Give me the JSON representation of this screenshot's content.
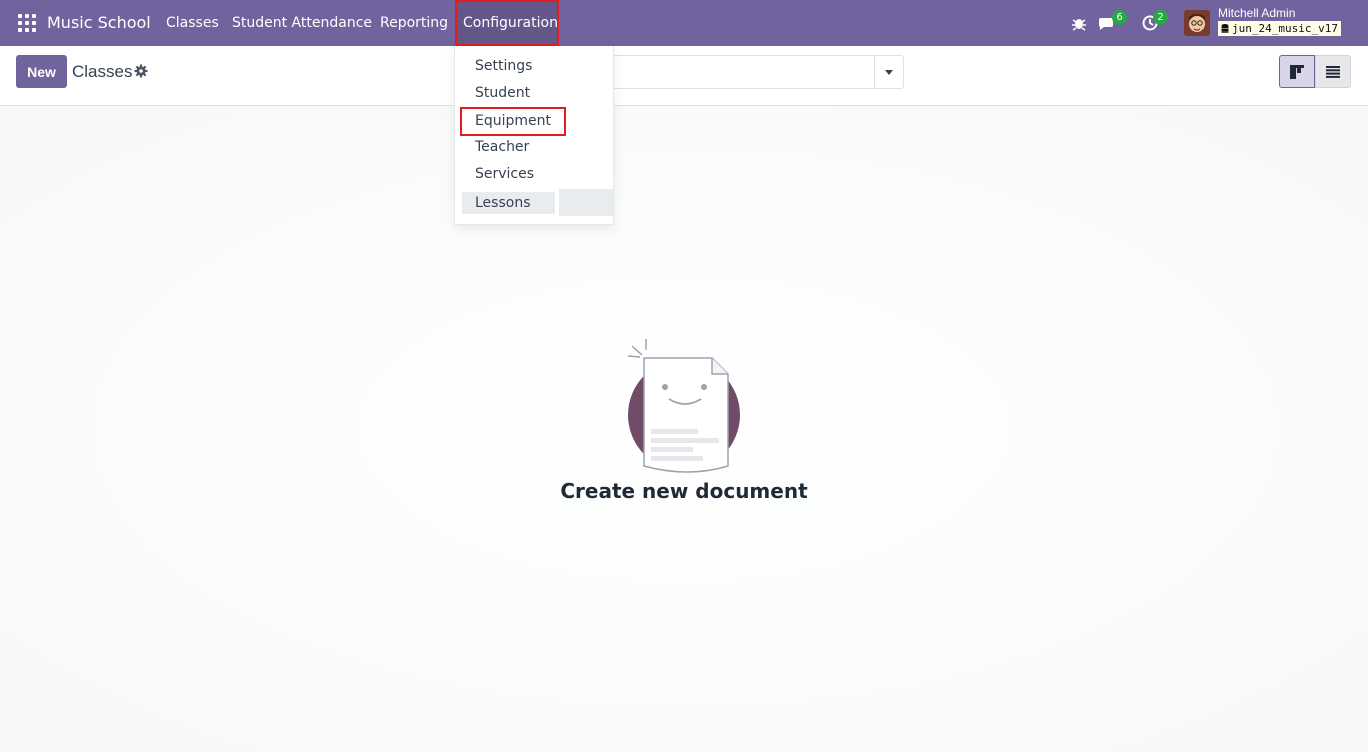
{
  "navbar": {
    "app_name": "Music School",
    "menu": [
      {
        "label": "Classes"
      },
      {
        "label": "Student Attendance"
      },
      {
        "label": "Reporting"
      },
      {
        "label": "Configuration"
      }
    ],
    "messages_count": "6",
    "activities_count": "2",
    "user_name": "Mitchell Admin",
    "database": "jun_24_music_v17"
  },
  "control_panel": {
    "new_label": "New",
    "breadcrumb": "Classes",
    "search_placeholder": ""
  },
  "dropdown": {
    "items": [
      {
        "label": "Settings"
      },
      {
        "label": "Student"
      },
      {
        "label": "Equipment"
      },
      {
        "label": "Teacher"
      },
      {
        "label": "Services"
      },
      {
        "label": "Lessons"
      }
    ]
  },
  "empty_state": {
    "title": "Create new document"
  },
  "colors": {
    "brand": "#71639e",
    "badge": "#28a745",
    "highlight": "#e11d1d"
  }
}
